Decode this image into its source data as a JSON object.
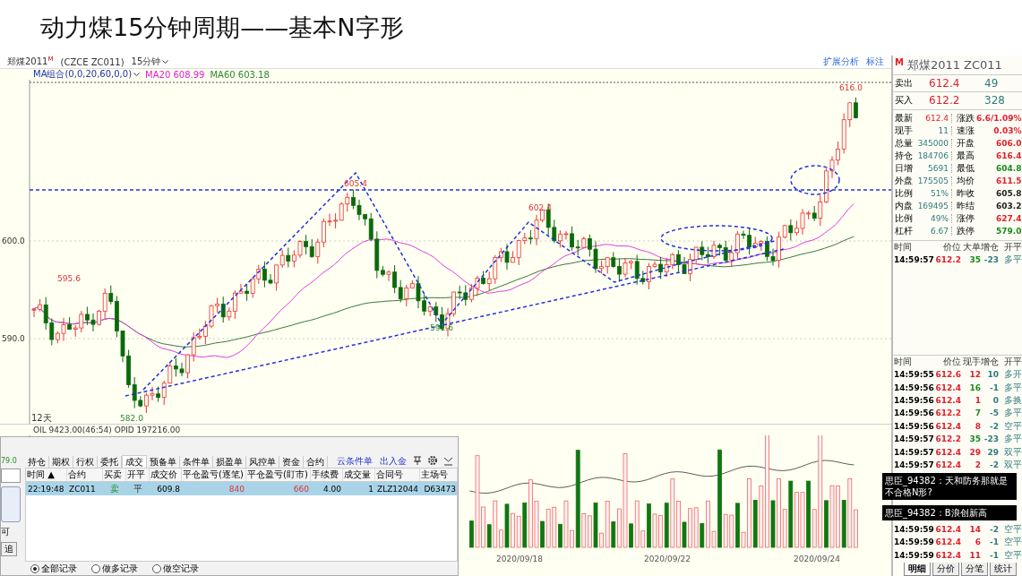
{
  "slide_title": "动力煤15分钟周期——基本N字形",
  "chart_header": {
    "symbol": "郑煤2011",
    "symbol_mark": "M",
    "code": "(CZCE ZC011)",
    "period": "15分钟",
    "tools": [
      "扩展分析",
      "标注"
    ]
  },
  "ma_legend": {
    "group": "MA组合(0,0,20,60,0,0)",
    "ma20": "MA20 608.99",
    "ma60": "MA60 603.18"
  },
  "price_chart": {
    "axis_labels": [
      "600.0",
      "590.0"
    ],
    "point_labels": [
      "595.6",
      "605.4",
      "602.4",
      "591.6",
      "582.0",
      "616.0"
    ],
    "period_label": "12天"
  },
  "volume_header": "OIL 9423.00(46:54) OPID 197216.00",
  "date_labels": [
    "2020/09/18",
    "2020/09/22",
    "2020/09/24"
  ],
  "order_window": {
    "side_texts": [
      "79.0",
      "可",
      "追"
    ],
    "tabs": [
      {
        "label": "持仓",
        "selected": false
      },
      {
        "label": "期权",
        "selected": false
      },
      {
        "label": "行权",
        "selected": false
      },
      {
        "label": "委托",
        "selected": false
      },
      {
        "label": "成交",
        "selected": true
      },
      {
        "label": "预备单",
        "selected": false
      },
      {
        "label": "条件单",
        "selected": false
      },
      {
        "label": "损盈单",
        "selected": false
      },
      {
        "label": "风控单",
        "selected": false
      },
      {
        "label": "资金",
        "selected": false
      },
      {
        "label": "合约",
        "selected": false
      }
    ],
    "links": [
      "云条件单",
      "出入金"
    ],
    "columns": [
      "时间 ▲",
      "合约",
      "买卖",
      "开平",
      "成交价",
      "平仓盈亏(逐笔)",
      "平仓盈亏(盯市)",
      "手续费",
      "成交量",
      "合同号",
      "主场号"
    ],
    "rows": [
      {
        "selected": true,
        "cells": [
          "22:19:48",
          "ZC011",
          "卖",
          "平",
          "609.8",
          "840",
          "660",
          "4.00",
          "1",
          "ZLZ12044",
          "D63473"
        ]
      }
    ],
    "filters": [
      {
        "label": "全部记录",
        "selected": true
      },
      {
        "label": "做多记录",
        "selected": false
      },
      {
        "label": "做空记录",
        "selected": false
      }
    ]
  },
  "quote_panel": {
    "name": "郑煤2011",
    "mark": "M",
    "code": "ZC011",
    "ask": {
      "label": "卖出",
      "price": "612.4",
      "volume": "49"
    },
    "bid": {
      "label": "买入",
      "price": "612.2",
      "volume": "328"
    },
    "stats": [
      {
        "label": "最新",
        "value": "612.4",
        "label2": "涨跌",
        "value2": "6.6/1.09%",
        "color": "#e0202a"
      },
      {
        "label": "现手",
        "value": "11",
        "label2": "速涨",
        "value2": "0.03%",
        "color": "#e0202a"
      },
      {
        "label": "总量",
        "value": "345000",
        "label2": "开盘",
        "value2": "606.0",
        "color": "#e0202a"
      },
      {
        "label": "持仓",
        "value": "184706",
        "label2": "最高",
        "value2": "616.4",
        "color": "#e0202a"
      },
      {
        "label": "日增",
        "value": "5691",
        "label2": "最低",
        "value2": "604.8",
        "color": "#1a8a1a"
      },
      {
        "label": "外盘",
        "value": "175505",
        "label2": "均价",
        "value2": "611.5",
        "color": "#e0202a"
      },
      {
        "label": "比例",
        "value": "51%",
        "label2": "昨收",
        "value2": "605.8",
        "color": "#222222"
      },
      {
        "label": "内盘",
        "value": "169495",
        "label2": "昨结",
        "value2": "603.2",
        "color": "#222222"
      },
      {
        "label": "比例",
        "value": "49%",
        "label2": "涨停",
        "value2": "627.4",
        "color": "#e0202a"
      },
      {
        "label": "杠杆",
        "value": "6.67",
        "label2": "跌停",
        "value2": "579.0",
        "color": "#1a8a1a"
      }
    ],
    "big_order_columns": [
      "时间",
      "价位",
      "大单",
      "增仓",
      "开平"
    ],
    "big_orders": [
      {
        "cells": [
          "14:59:57",
          "612.2",
          "35",
          "-23",
          "多平"
        ]
      }
    ],
    "trade_columns": [
      "时间",
      "价位",
      "现手",
      "增仓",
      "开平"
    ],
    "trades_top": [
      {
        "cells": [
          "14:59:55",
          "612.6",
          "12",
          "10",
          "多开"
        ],
        "color": "#e0202a"
      },
      {
        "cells": [
          "14:59:56",
          "612.4",
          "16",
          "-1",
          "多平"
        ],
        "color": "#1a8a1a"
      },
      {
        "cells": [
          "14:59:56",
          "612.4",
          "1",
          "0",
          "多换"
        ],
        "color": "#e0202a"
      },
      {
        "cells": [
          "14:59:56",
          "612.2",
          "7",
          "-5",
          "多平"
        ],
        "color": "#1a8a1a"
      },
      {
        "cells": [
          "14:59:56",
          "612.4",
          "8",
          "-2",
          "空平"
        ],
        "color": "#e0202a"
      },
      {
        "cells": [
          "14:59:57",
          "612.2",
          "35",
          "-23",
          "多平"
        ],
        "color": "#1a8a1a"
      },
      {
        "cells": [
          "14:59:57",
          "612.4",
          "29",
          "29",
          "双平"
        ],
        "color": "#e0202a"
      },
      {
        "cells": [
          "14:59:57",
          "612.4",
          "2",
          "-2",
          "双平"
        ],
        "color": "#e0202a"
      }
    ],
    "trades_bottom": [
      {
        "cells": [
          "14:59:59",
          "612.4",
          "14",
          "-2",
          "空平"
        ],
        "color": "#e0202a"
      },
      {
        "cells": [
          "14:59:59",
          "612.4",
          "6",
          "-1",
          "空平"
        ],
        "color": "#e0202a"
      },
      {
        "cells": [
          "14:59:59",
          "612.4",
          "11",
          "-1",
          "空平"
        ],
        "color": "#e0202a"
      }
    ],
    "bottom_tabs": [
      {
        "label": "明细",
        "selected": true
      },
      {
        "label": "分价",
        "selected": false
      },
      {
        "label": "分笔",
        "selected": false
      },
      {
        "label": "统计",
        "selected": false
      }
    ]
  },
  "chat_messages": [
    "思臣_94382：天和防务那就是不合格N形?",
    "思臣_94382：B浪创新高"
  ]
}
